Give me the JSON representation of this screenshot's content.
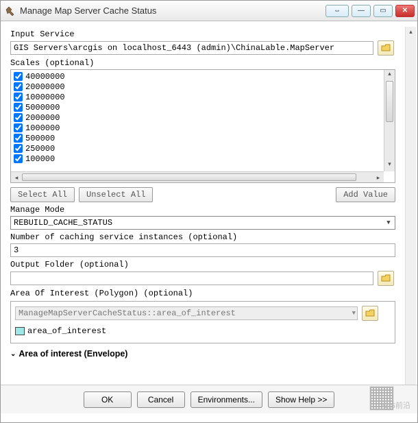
{
  "window": {
    "title": "Manage Map Server Cache Status"
  },
  "input_service": {
    "label": "Input Service",
    "value": "GIS Servers\\arcgis on localhost_6443 (admin)\\ChinaLable.MapServer"
  },
  "scales": {
    "label": "Scales (optional)",
    "items": [
      "40000000",
      "20000000",
      "10000000",
      "5000000",
      "2000000",
      "1000000",
      "500000",
      "250000",
      "100000"
    ],
    "select_all": "Select All",
    "unselect_all": "Unselect All",
    "add_value": "Add Value"
  },
  "manage_mode": {
    "label": "Manage Mode",
    "value": "REBUILD_CACHE_STATUS"
  },
  "instances": {
    "label": "Number of caching service instances (optional)",
    "value": "3"
  },
  "output_folder": {
    "label": "Output Folder (optional)",
    "value": ""
  },
  "aoi_polygon": {
    "label": "Area Of Interest (Polygon) (optional)",
    "combo_value": "ManageMapServerCacheStatus::area_of_interest",
    "layer_name": "area_of_interest"
  },
  "aoi_envelope": {
    "label": "Area of interest (Envelope)"
  },
  "footer": {
    "ok": "OK",
    "cancel": "Cancel",
    "environments": "Environments...",
    "show_help": "Show Help >>"
  },
  "watermark": "GIS前沿"
}
